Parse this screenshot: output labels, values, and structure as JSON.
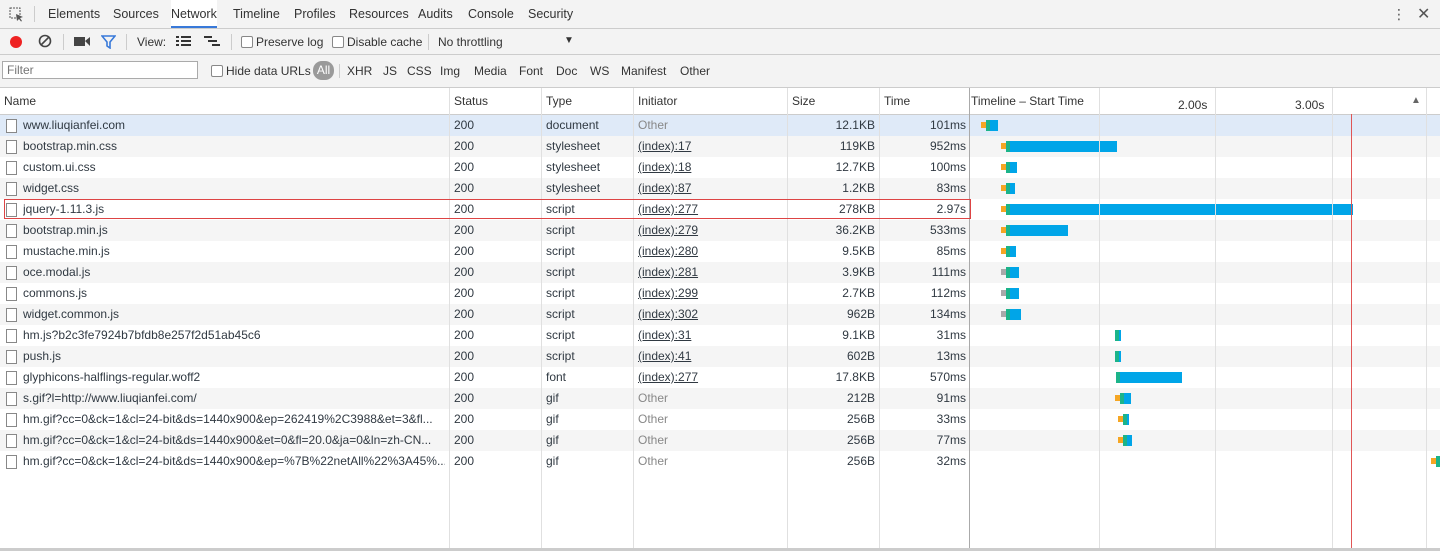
{
  "tabs": [
    "Elements",
    "Sources",
    "Network",
    "Timeline",
    "Profiles",
    "Resources",
    "Audits",
    "Console",
    "Security"
  ],
  "active_tab": "Network",
  "controls": {
    "view_label": "View:",
    "preserve_log": "Preserve log",
    "disable_cache": "Disable cache",
    "throttling": "No throttling"
  },
  "filter": {
    "placeholder": "Filter",
    "hide_data_urls": "Hide data URLs",
    "types": [
      "All",
      "XHR",
      "JS",
      "CSS",
      "Img",
      "Media",
      "Font",
      "Doc",
      "WS",
      "Manifest",
      "Other"
    ]
  },
  "columns": {
    "name": "Name",
    "status": "Status",
    "type": "Type",
    "initiator": "Initiator",
    "size": "Size",
    "time": "Time",
    "timeline": "Timeline – Start Time",
    "tick1": "2.00s",
    "tick2": "3.00s"
  },
  "colors": {
    "bar_main": "#00a5e8",
    "bar_teal": "#1bb48a",
    "bar_orange": "#f5a623",
    "bar_gray": "#a9a9a9",
    "marker": "#e05555",
    "selected_row": "#dfeaf8"
  },
  "requests": [
    {
      "name": "www.liuqianfei.com",
      "status": "200",
      "type": "document",
      "initiator": "Other",
      "size": "12.1KB",
      "time": "101ms",
      "start_s": 0.05,
      "dur_s": 0.101
    },
    {
      "name": "bootstrap.min.css",
      "status": "200",
      "type": "stylesheet",
      "initiator": "(index):17",
      "size": "119KB",
      "time": "952ms",
      "start_s": 0.22,
      "dur_s": 0.952
    },
    {
      "name": "custom.ui.css",
      "status": "200",
      "type": "stylesheet",
      "initiator": "(index):18",
      "size": "12.7KB",
      "time": "100ms",
      "start_s": 0.22,
      "dur_s": 0.1
    },
    {
      "name": "widget.css",
      "status": "200",
      "type": "stylesheet",
      "initiator": "(index):87",
      "size": "1.2KB",
      "time": "83ms",
      "start_s": 0.22,
      "dur_s": 0.083
    },
    {
      "name": "jquery-1.11.3.js",
      "status": "200",
      "type": "script",
      "initiator": "(index):277",
      "size": "278KB",
      "time": "2.97s",
      "start_s": 0.22,
      "dur_s": 2.97
    },
    {
      "name": "bootstrap.min.js",
      "status": "200",
      "type": "script",
      "initiator": "(index):279",
      "size": "36.2KB",
      "time": "533ms",
      "start_s": 0.22,
      "dur_s": 0.533
    },
    {
      "name": "mustache.min.js",
      "status": "200",
      "type": "script",
      "initiator": "(index):280",
      "size": "9.5KB",
      "time": "85ms",
      "start_s": 0.22,
      "dur_s": 0.085
    },
    {
      "name": "oce.modal.js",
      "status": "200",
      "type": "script",
      "initiator": "(index):281",
      "size": "3.9KB",
      "time": "111ms",
      "start_s": 0.22,
      "dur_s": 0.111
    },
    {
      "name": "commons.js",
      "status": "200",
      "type": "script",
      "initiator": "(index):299",
      "size": "2.7KB",
      "time": "112ms",
      "start_s": 0.22,
      "dur_s": 0.112
    },
    {
      "name": "widget.common.js",
      "status": "200",
      "type": "script",
      "initiator": "(index):302",
      "size": "962B",
      "time": "134ms",
      "start_s": 0.22,
      "dur_s": 0.134
    },
    {
      "name": "hm.js?b2c3fe7924b7bfdb8e257f2d51ab45c6",
      "status": "200",
      "type": "script",
      "initiator": "(index):31",
      "size": "9.1KB",
      "time": "31ms",
      "start_s": 1.15,
      "dur_s": 0.031
    },
    {
      "name": "push.js",
      "status": "200",
      "type": "script",
      "initiator": "(index):41",
      "size": "602B",
      "time": "13ms",
      "start_s": 1.15,
      "dur_s": 0.013
    },
    {
      "name": "glyphicons-halflings-regular.woff2",
      "status": "200",
      "type": "font",
      "initiator": "(index):277",
      "size": "17.8KB",
      "time": "570ms",
      "start_s": 1.16,
      "dur_s": 0.57
    },
    {
      "name": "s.gif?l=http://www.liuqianfei.com/",
      "status": "200",
      "type": "gif",
      "initiator": "Other",
      "size": "212B",
      "time": "91ms",
      "start_s": 1.2,
      "dur_s": 0.091
    },
    {
      "name": "hm.gif?cc=0&ck=1&cl=24-bit&ds=1440x900&ep=262419%2C3988&et=3&fl...",
      "status": "200",
      "type": "gif",
      "initiator": "Other",
      "size": "256B",
      "time": "33ms",
      "start_s": 1.22,
      "dur_s": 0.033
    },
    {
      "name": "hm.gif?cc=0&ck=1&cl=24-bit&ds=1440x900&et=0&fl=20.0&ja=0&ln=zh-CN...",
      "status": "200",
      "type": "gif",
      "initiator": "Other",
      "size": "256B",
      "time": "77ms",
      "start_s": 1.22,
      "dur_s": 0.077
    },
    {
      "name": "hm.gif?cc=0&ck=1&cl=24-bit&ds=1440x900&ep=%7B%22netAll%22%3A45%...",
      "status": "200",
      "type": "gif",
      "initiator": "Other",
      "size": "256B",
      "time": "32ms",
      "start_s": 3.9,
      "dur_s": 0.032
    }
  ],
  "selected_index": 0,
  "highlighted_index": 4
}
